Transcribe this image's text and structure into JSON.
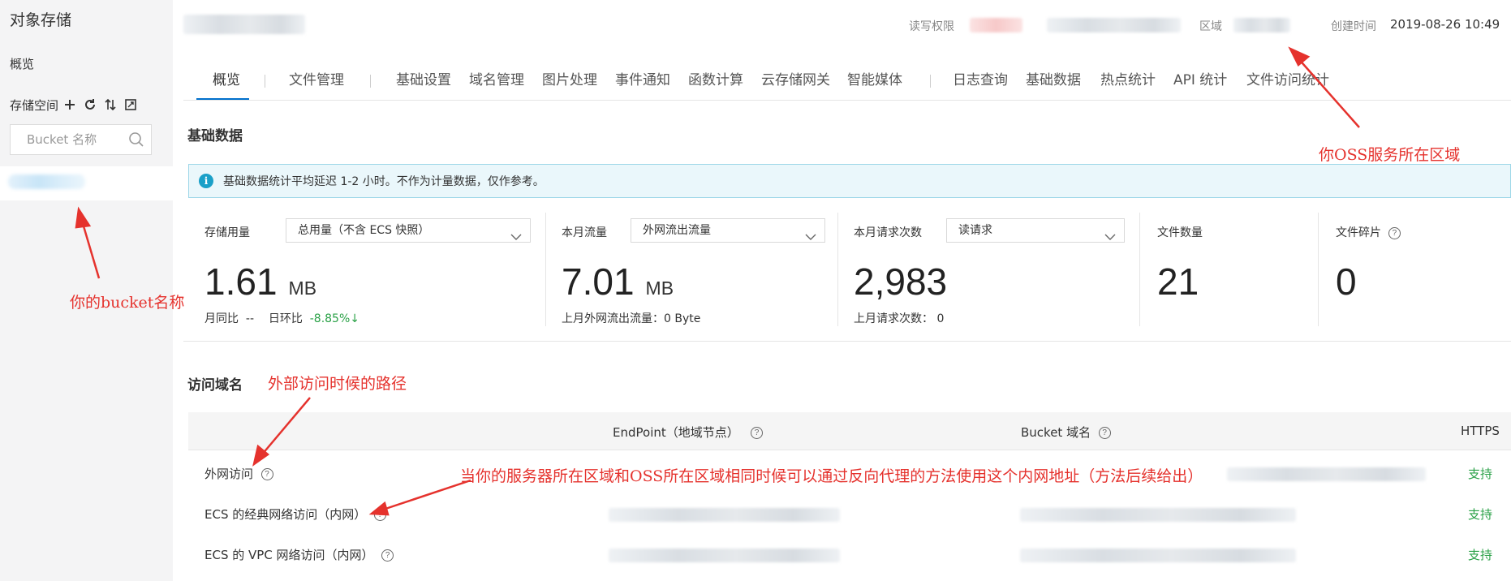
{
  "sidebar": {
    "title": "对象存储",
    "overview": "概览",
    "storage_label": "存储空间",
    "tools": [
      "plus-icon",
      "refresh-icon",
      "sort-icon",
      "expand-icon"
    ],
    "search": {
      "placeholder": "Bucket 名称"
    }
  },
  "header": {
    "permission_label": "读写权限",
    "region_label": "区域",
    "created_label": "创建时间",
    "created_value": "2019-08-26 10:49"
  },
  "tabs": [
    {
      "label": "概览",
      "active": true
    },
    {
      "label": "文件管理"
    },
    {
      "label": "基础设置"
    },
    {
      "label": "域名管理"
    },
    {
      "label": "图片处理"
    },
    {
      "label": "事件通知"
    },
    {
      "label": "函数计算"
    },
    {
      "label": "云存储网关"
    },
    {
      "label": "智能媒体"
    },
    {
      "label": "日志查询"
    },
    {
      "label": "基础数据"
    },
    {
      "label": "热点统计"
    },
    {
      "label": "API 统计"
    },
    {
      "label": "文件访问统计"
    }
  ],
  "basic_data": {
    "title": "基础数据",
    "notice": "基础数据统计平均延迟 1-2 小时。不作为计量数据，仅作参考。",
    "cards": [
      {
        "label": "存储用量",
        "select": "总用量（不含 ECS 快照）",
        "value": "1.61",
        "unit": "MB",
        "sub": {
          "mom_label": "月同比",
          "mom_value": "--",
          "dod_label": "日环比",
          "dod_value": "-8.85%↓"
        }
      },
      {
        "label": "本月流量",
        "select": "外网流出流量",
        "value": "7.01",
        "unit": "MB",
        "sub_text": "上月外网流出流量：0 Byte"
      },
      {
        "label": "本月请求次数",
        "select": "读请求",
        "value": "2,983",
        "sub_text": "上月请求次数：  0"
      },
      {
        "label": "文件数量",
        "value": "21"
      },
      {
        "label": "文件碎片",
        "value": "0"
      }
    ]
  },
  "access_domain": {
    "title": "访问域名",
    "columns": [
      "EndPoint（地域节点）",
      "Bucket 域名",
      "HTTPS"
    ],
    "rows": [
      {
        "name": "外网访问",
        "https": "支持"
      },
      {
        "name": "ECS 的经典网络访问（内网）",
        "https": "支持"
      },
      {
        "name": "ECS 的 VPC 网络访问（内网）",
        "https": "支持"
      }
    ]
  },
  "annotations": {
    "region": "你OSS服务所在区域",
    "bucket": "你的bucket名称",
    "external": "外部访问时候的路径",
    "intranet": "当你的服务器所在区域和OSS所在区域相同时候可以通过反向代理的方法使用这个内网地址（方法后续给出）"
  },
  "colors": {
    "accent": "#0070cc",
    "success": "#2aa147",
    "annotation": "#e5322d",
    "notice_bg": "#eaf7fb"
  }
}
